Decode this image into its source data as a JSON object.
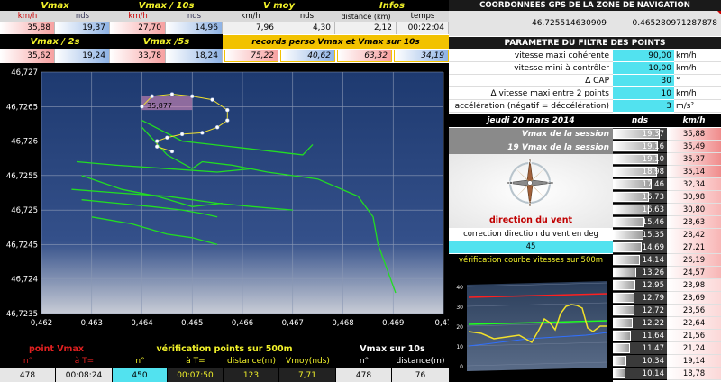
{
  "top": {
    "headers": [
      "Vmax",
      "Vmax / 10s",
      "V moy",
      "Infos"
    ],
    "sub": [
      "km/h",
      "nds",
      "km/h",
      "nds",
      "km/h",
      "nds",
      "distance (km)",
      "temps"
    ],
    "vals": [
      "35,88",
      "19,37",
      "27,70",
      "14,96",
      "7,96",
      "4,30",
      "2,12",
      "00:22:04"
    ],
    "headers2": [
      "Vmax / 2s",
      "Vmax /5s"
    ],
    "records_title": "records perso Vmax et Vmax sur 10s",
    "vals2": [
      "35,62",
      "19,24",
      "33,78",
      "18,24"
    ],
    "records": [
      "75,22",
      "40,62",
      "63,32",
      "34,19"
    ]
  },
  "coords": {
    "title": "COORDONNEES GPS DE LA ZONE DE NAVIGATION",
    "lat": "46.725514630909",
    "lon": "0.465280971287878"
  },
  "params": {
    "title": "PARAMETRE DU FILTRE DES POINTS",
    "rows": [
      {
        "label": "vitesse maxi cohérente",
        "value": "90,00",
        "unit": "km/h"
      },
      {
        "label": "vitesse mini à contrôler",
        "value": "10,00",
        "unit": "km/h"
      },
      {
        "label": "Δ CAP",
        "value": "30",
        "unit": "°"
      },
      {
        "label": "Δ vitesse maxi entre 2 points",
        "value": "10",
        "unit": "km/h"
      },
      {
        "label": "accélération (négatif = déccélération)",
        "value": "3",
        "unit": "m/s²"
      }
    ]
  },
  "session": {
    "date": "jeudi 20 mars 2014",
    "col_nds": "nds",
    "col_kmh": "km/h",
    "vmax_label": "Vmax de la session",
    "vmax19_label": "19 Vmax de la session",
    "wind_title": "direction du vent",
    "wind_corr_label": "correction direction du vent en deg",
    "wind_corr_value": "45",
    "compass_letters": [
      "N",
      "E",
      "S",
      "O"
    ],
    "verif_title": "vérification courbe vitesses sur 500m",
    "mini_chart_y_ticks": [
      "40",
      "30",
      "20",
      "10",
      "0"
    ],
    "list": [
      {
        "nds": "19,37",
        "kmh": "35,88",
        "fill": 1.0
      },
      {
        "nds": "19,16",
        "kmh": "35,49",
        "fill": 0.97
      },
      {
        "nds": "19,10",
        "kmh": "35,37",
        "fill": 0.96
      },
      {
        "nds": "18,98",
        "kmh": "35,14",
        "fill": 0.94
      },
      {
        "nds": "17,46",
        "kmh": "32,34",
        "fill": 0.82
      },
      {
        "nds": "16,73",
        "kmh": "30,98",
        "fill": 0.77
      },
      {
        "nds": "16,63",
        "kmh": "30,80",
        "fill": 0.76
      },
      {
        "nds": "15,46",
        "kmh": "28,63",
        "fill": 0.67
      },
      {
        "nds": "15,35",
        "kmh": "28,42",
        "fill": 0.66
      },
      {
        "nds": "14,69",
        "kmh": "27,21",
        "fill": 0.61
      },
      {
        "nds": "14,14",
        "kmh": "26,19",
        "fill": 0.57
      },
      {
        "nds": "13,26",
        "kmh": "24,57",
        "fill": 0.5
      },
      {
        "nds": "12,95",
        "kmh": "23,98",
        "fill": 0.48
      },
      {
        "nds": "12,79",
        "kmh": "23,69",
        "fill": 0.47
      },
      {
        "nds": "12,72",
        "kmh": "23,56",
        "fill": 0.46
      },
      {
        "nds": "12,22",
        "kmh": "22,64",
        "fill": 0.43
      },
      {
        "nds": "11,64",
        "kmh": "21,56",
        "fill": 0.38
      },
      {
        "nds": "11,47",
        "kmh": "21,24",
        "fill": 0.37
      },
      {
        "nds": "10,34",
        "kmh": "19,14",
        "fill": 0.29
      },
      {
        "nds": "10,14",
        "kmh": "18,78",
        "fill": 0.27
      }
    ]
  },
  "bottom": {
    "point_vmax": "point Vmax",
    "verif_points": "vérification points sur 500m",
    "vmax10": "Vmax sur 10s",
    "sub": [
      "n°",
      "à T=",
      "n°",
      "à T=",
      "distance(m)",
      "Vmoy(nds)",
      "n°",
      "distance(m)"
    ],
    "vals": [
      "478",
      "00:08:24",
      "450",
      "00:07:50",
      "123",
      "7,71",
      "478",
      "76"
    ]
  },
  "chart_data": {
    "type": "line",
    "title": "",
    "xlabel": "",
    "ylabel": "",
    "xlim": [
      0.462,
      0.47
    ],
    "ylim": [
      46.7235,
      46.727
    ],
    "x_ticks": [
      "0,462",
      "0,463",
      "0,464",
      "0,465",
      "0,466",
      "0,467",
      "0,468",
      "0,469",
      "0,47"
    ],
    "y_ticks": [
      "46,727",
      "46,7265",
      "46,726",
      "46,7255",
      "46,725",
      "46,7245",
      "46,724",
      "46,7235"
    ],
    "grid": true,
    "point_label": "35,877",
    "track_color": "#22dd22",
    "series": [
      {
        "color": "#22dd22",
        "points": [
          [
            0.464,
            46.7263
          ],
          [
            0.4648,
            46.726
          ],
          [
            0.466,
            46.7259
          ],
          [
            0.4672,
            46.7258
          ],
          [
            0.4674,
            46.72595
          ]
        ]
      },
      {
        "color": "#22dd22",
        "points": [
          [
            0.464,
            46.7262
          ],
          [
            0.4645,
            46.7258
          ],
          [
            0.465,
            46.7256
          ],
          [
            0.4652,
            46.7257
          ],
          [
            0.4658,
            46.72565
          ],
          [
            0.4665,
            46.72555
          ],
          [
            0.4675,
            46.72545
          ],
          [
            0.4683,
            46.7252
          ],
          [
            0.4686,
            46.7249
          ],
          [
            0.4687,
            46.7245
          ],
          [
            0.4689,
            46.7241
          ],
          [
            0.46905,
            46.7238
          ]
        ]
      },
      {
        "color": "#22dd22",
        "points": [
          [
            0.4627,
            46.7257
          ],
          [
            0.4635,
            46.72565
          ],
          [
            0.4645,
            46.7256
          ],
          [
            0.4655,
            46.72555
          ],
          [
            0.4662,
            46.7256
          ]
        ]
      },
      {
        "color": "#22dd22",
        "points": [
          [
            0.4626,
            46.7253
          ],
          [
            0.4635,
            46.72525
          ],
          [
            0.4645,
            46.7252
          ],
          [
            0.4655,
            46.7251
          ],
          [
            0.4662,
            46.72505
          ],
          [
            0.467,
            46.725
          ]
        ]
      },
      {
        "color": "#22dd22",
        "points": [
          [
            0.4628,
            46.7255
          ],
          [
            0.4636,
            46.7253
          ],
          [
            0.4643,
            46.7252
          ],
          [
            0.465,
            46.72505
          ],
          [
            0.4656,
            46.7251
          ]
        ]
      },
      {
        "color": "#22dd22",
        "points": [
          [
            0.4628,
            46.72515
          ],
          [
            0.4635,
            46.7251
          ],
          [
            0.4642,
            46.72505
          ],
          [
            0.4648,
            46.725
          ],
          [
            0.4652,
            46.72495
          ],
          [
            0.4655,
            46.7249
          ]
        ]
      },
      {
        "color": "#22dd22",
        "points": [
          [
            0.463,
            46.7249
          ],
          [
            0.4638,
            46.7248
          ],
          [
            0.4645,
            46.72465
          ],
          [
            0.465,
            46.7246
          ],
          [
            0.4655,
            46.7245
          ]
        ]
      }
    ],
    "highlight": {
      "color": "#ffffff",
      "points": [
        [
          0.464,
          46.7265
        ],
        [
          0.4642,
          46.72665
        ],
        [
          0.4646,
          46.72668
        ],
        [
          0.465,
          46.72665
        ],
        [
          0.4654,
          46.7266
        ],
        [
          0.4657,
          46.72645
        ],
        [
          0.4657,
          46.7263
        ],
        [
          0.4655,
          46.7262
        ],
        [
          0.4652,
          46.72612
        ],
        [
          0.4648,
          46.7261
        ],
        [
          0.4645,
          46.72605
        ],
        [
          0.4643,
          46.726
        ],
        [
          0.4643,
          46.72592
        ],
        [
          0.4646,
          46.72585
        ]
      ]
    },
    "pink_box": [
      [
        0.464,
        46.72665
      ],
      [
        0.465,
        46.72645
      ]
    ]
  }
}
